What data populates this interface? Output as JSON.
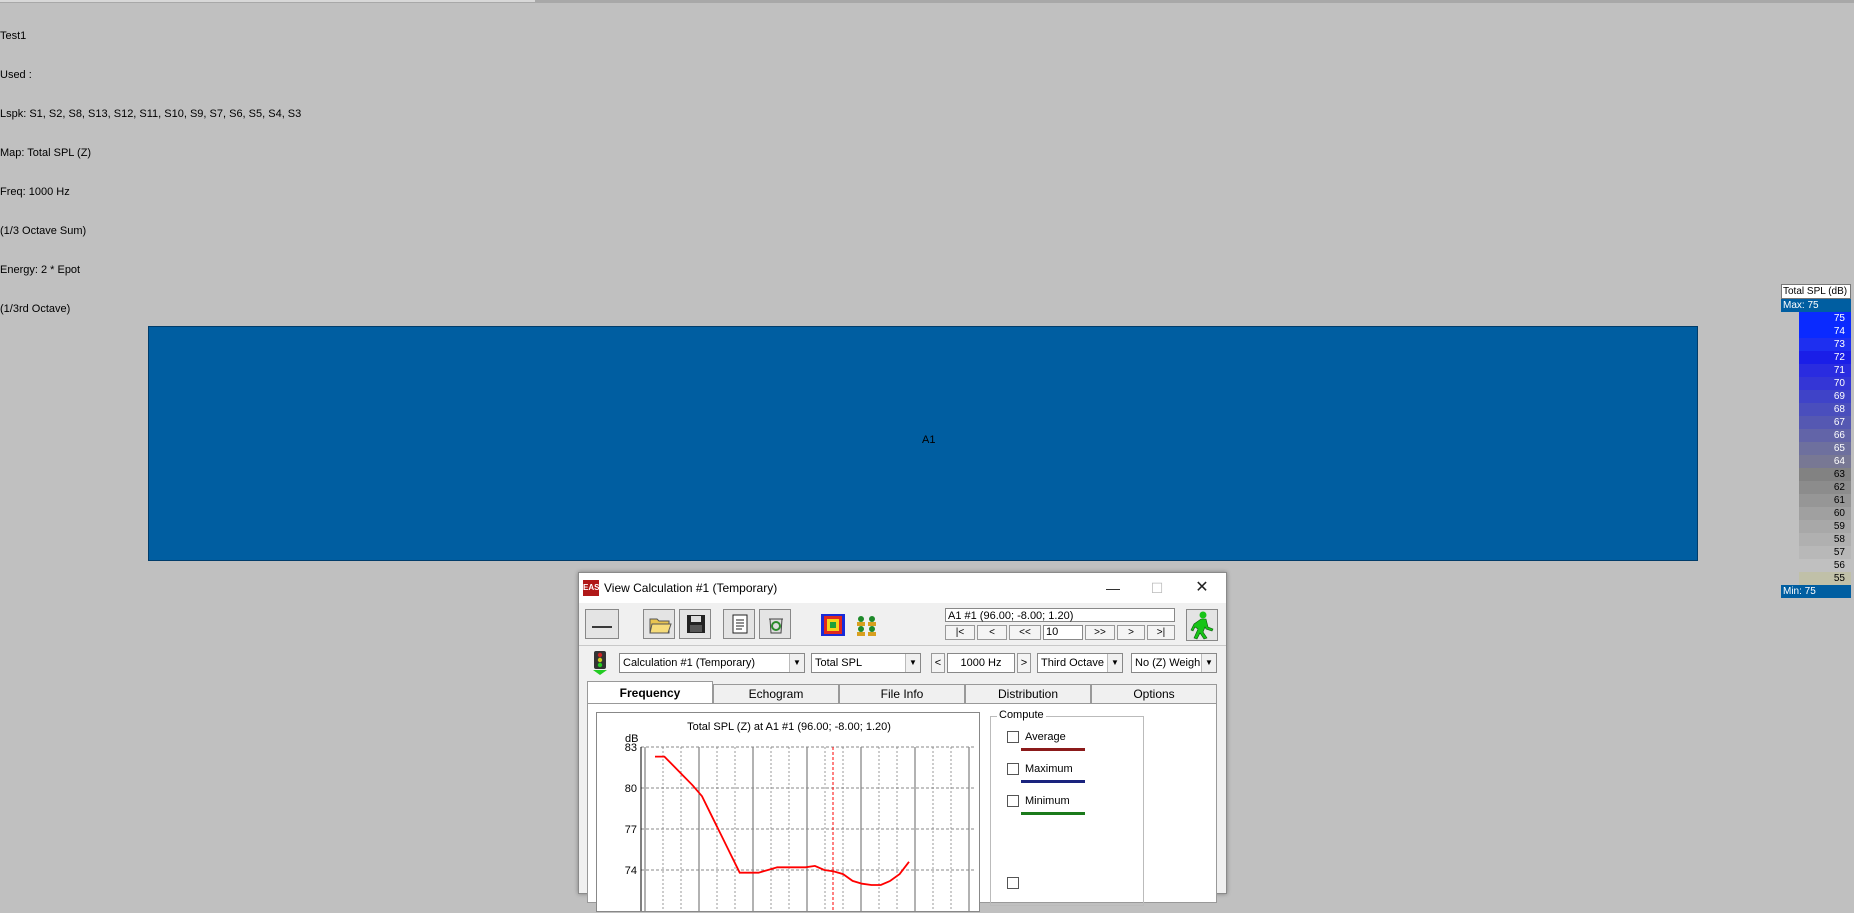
{
  "info": {
    "lines": [
      "Test1",
      "Used :",
      "Lspk: S1, S2, S8, S13, S12, S11, S10, S9, S7, S6, S5, S4, S3",
      "Map: Total SPL (Z)",
      "Freq: 1000 Hz",
      "(1/3 Octave Sum)",
      "Energy: 2 * Epot",
      "(1/3rd Octave)"
    ]
  },
  "map": {
    "area_label": "A1",
    "fill_color": "#005ea1"
  },
  "legend": {
    "title": "Total SPL (dB)",
    "max_label": "Max:  75",
    "min_label": "Min:  75",
    "levels": [
      {
        "value": "75",
        "color": "#0a2aff"
      },
      {
        "value": "74",
        "color": "#0a2aff"
      },
      {
        "value": "73",
        "color": "#1e2ff0"
      },
      {
        "value": "72",
        "color": "#1a1ee8"
      },
      {
        "value": "71",
        "color": "#2a2ce0"
      },
      {
        "value": "70",
        "color": "#3436d6"
      },
      {
        "value": "69",
        "color": "#3f43c8"
      },
      {
        "value": "68",
        "color": "#4a4ebd"
      },
      {
        "value": "67",
        "color": "#5558b2"
      },
      {
        "value": "66",
        "color": "#6264a8"
      },
      {
        "value": "65",
        "color": "#6e709e"
      },
      {
        "value": "64",
        "color": "#787894"
      },
      {
        "value": "63",
        "color": "#828282"
      },
      {
        "value": "62",
        "color": "#8c8c8c"
      },
      {
        "value": "61",
        "color": "#969696"
      },
      {
        "value": "60",
        "color": "#a0a0a0"
      },
      {
        "value": "59",
        "color": "#a8a8a8"
      },
      {
        "value": "58",
        "color": "#b0b0b0"
      },
      {
        "value": "57",
        "color": "#b8b8b8"
      },
      {
        "value": "56",
        "color": "#c0c0c0"
      },
      {
        "value": "55",
        "color": "#c0c0a8"
      }
    ]
  },
  "dialog": {
    "title": "View Calculation #1 (Temporary)",
    "app_icon": "EASE",
    "minimize": "—",
    "maximize": "☐",
    "close": "✕",
    "coord": "A1 #1  (96.00; -8.00; 1.20)",
    "nav": {
      "first": "|<",
      "prev": "<",
      "prev_fast": "<<",
      "step": "10",
      "next_fast": ">>",
      "next": ">",
      "last": ">|"
    },
    "selects": {
      "calculation": "Calculation #1 (Temporary)",
      "quantity": "Total SPL",
      "freq": "1000 Hz",
      "freq_prev": "<",
      "freq_next": ">",
      "band": "Third Octave",
      "weighting": "No (Z) Weigh"
    },
    "tabs": [
      "Frequency",
      "Echogram",
      "File Info",
      "Distribution",
      "Options"
    ],
    "compute": {
      "title": "Compute",
      "items": [
        {
          "label": "Average",
          "color": "#8b1a1a"
        },
        {
          "label": "Maximum",
          "color": "#1a237e"
        },
        {
          "label": "Minimum",
          "color": "#1b7a1b"
        }
      ]
    }
  },
  "chart_data": {
    "type": "line",
    "title": "Total SPL (Z) at A1 #1  (96.00; -8.00; 1.20)",
    "ylabel": "dB",
    "y_ticks": [
      "83",
      "80",
      "77",
      "74"
    ],
    "ylim": [
      71,
      83
    ],
    "x": [
      1,
      2,
      3,
      4,
      5,
      6,
      7,
      8,
      9,
      10,
      11,
      12,
      13,
      14,
      15,
      16,
      17,
      18,
      19,
      20,
      21
    ],
    "values": [
      82.3,
      82.3,
      81.6,
      80.9,
      80.2,
      79.4,
      78.0,
      76.6,
      75.2,
      73.8,
      73.8,
      73.8,
      74.0,
      74.2,
      74.2,
      74.2,
      74.2,
      74.3,
      74.0,
      73.9,
      73.7,
      73.2,
      73.0,
      72.9,
      72.9,
      73.2,
      73.7,
      74.6
    ],
    "series_color": "#ff0000",
    "cursor_index": 9,
    "grid": true
  }
}
